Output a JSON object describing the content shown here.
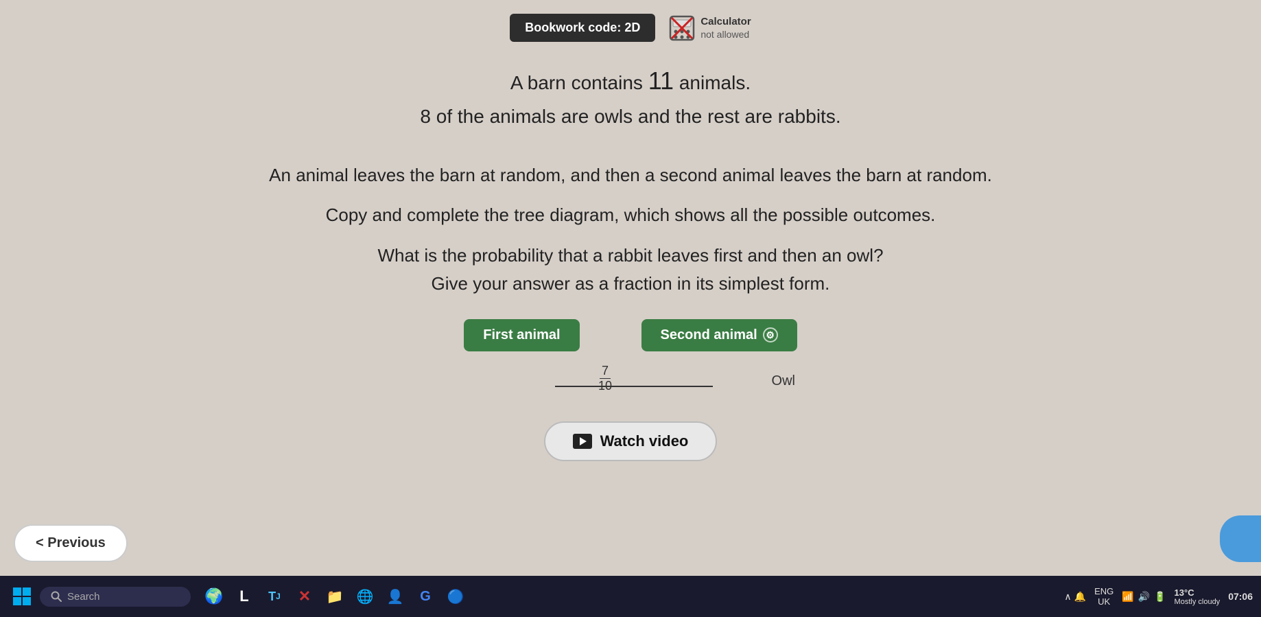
{
  "header": {
    "bookwork_label": "Bookwork code: 2D",
    "calculator_label": "Calculator",
    "calculator_sub": "not allowed"
  },
  "problem": {
    "line1": "A barn contains 11 animals.",
    "line2": "8 of the animals are owls and the rest are rabbits.",
    "line3": "An animal leaves the barn at random, and then a second animal leaves the barn at random.",
    "line4": "Copy and complete the tree diagram, which shows all the possible outcomes.",
    "line5": "What is the probability that a rabbit leaves first and then an owl?",
    "line6": "Give your answer as a fraction in its simplest form."
  },
  "diagram": {
    "first_animal_label": "First animal",
    "second_animal_label": "Second animal",
    "fraction_num": "7",
    "fraction_den": "10",
    "owl_label": "Owl"
  },
  "buttons": {
    "watch_video": "Watch video",
    "previous": "< Previous"
  },
  "taskbar": {
    "search_placeholder": "Search",
    "language": "ENG",
    "region": "UK",
    "time": "07:06",
    "weather_temp": "13°C",
    "weather_desc": "Mostly cloudy"
  }
}
